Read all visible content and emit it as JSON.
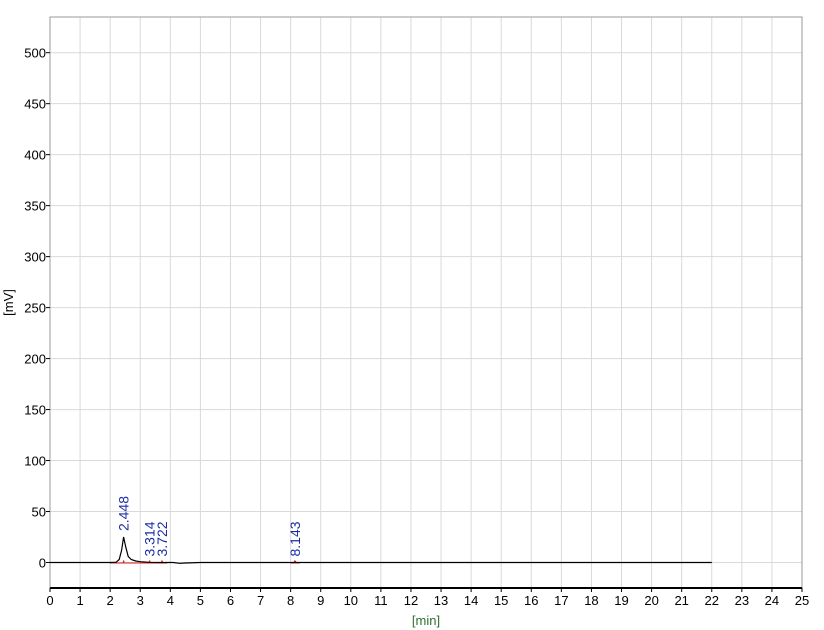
{
  "colors": {
    "background": "#ffffff",
    "plot_background": "#ffffff",
    "grid": "#d9d9d9",
    "frame": "#000000",
    "trace": "#000000",
    "peak_label": "#1a2da6",
    "peak_marker": "#d62020",
    "axis_title": "#000000",
    "xlabel": "#2f6f2f"
  },
  "chart_data": {
    "type": "line",
    "title": "",
    "xlabel": "[min]",
    "ylabel": "[mV]",
    "xlim": [
      0,
      25
    ],
    "ylim": [
      -25,
      535
    ],
    "x_ticks": [
      "0",
      "1",
      "2",
      "3",
      "4",
      "5",
      "6",
      "7",
      "8",
      "9",
      "10",
      "11",
      "12",
      "13",
      "14",
      "15",
      "16",
      "17",
      "18",
      "19",
      "20",
      "21",
      "22",
      "23",
      "24",
      "25"
    ],
    "y_ticks": [
      "0",
      "50",
      "100",
      "150",
      "200",
      "250",
      "300",
      "350",
      "400",
      "450",
      "500"
    ],
    "grid": true,
    "series": [
      {
        "x": [
          0.0,
          2.0,
          2.2,
          2.3,
          2.38,
          2.448,
          2.52,
          2.6,
          2.7,
          2.85,
          3.0,
          3.3,
          3.7,
          4.1,
          4.3,
          4.5,
          5.0,
          8.1,
          8.143,
          8.2,
          12.0,
          16.0,
          22.0
        ],
        "y": [
          0,
          0,
          0.3,
          3,
          12,
          25,
          15,
          6,
          3,
          1.5,
          0.8,
          0.2,
          0,
          0,
          -0.8,
          -0.5,
          0,
          0,
          0.5,
          0,
          0,
          0,
          0
        ]
      }
    ],
    "peaks": [
      {
        "label": "2.448",
        "x": 2.448,
        "y": 25
      },
      {
        "label": "3.314",
        "x": 3.314,
        "y": 0
      },
      {
        "label": "3.722",
        "x": 3.722,
        "y": 0
      },
      {
        "label": "8.143",
        "x": 8.143,
        "y": 0
      }
    ]
  }
}
